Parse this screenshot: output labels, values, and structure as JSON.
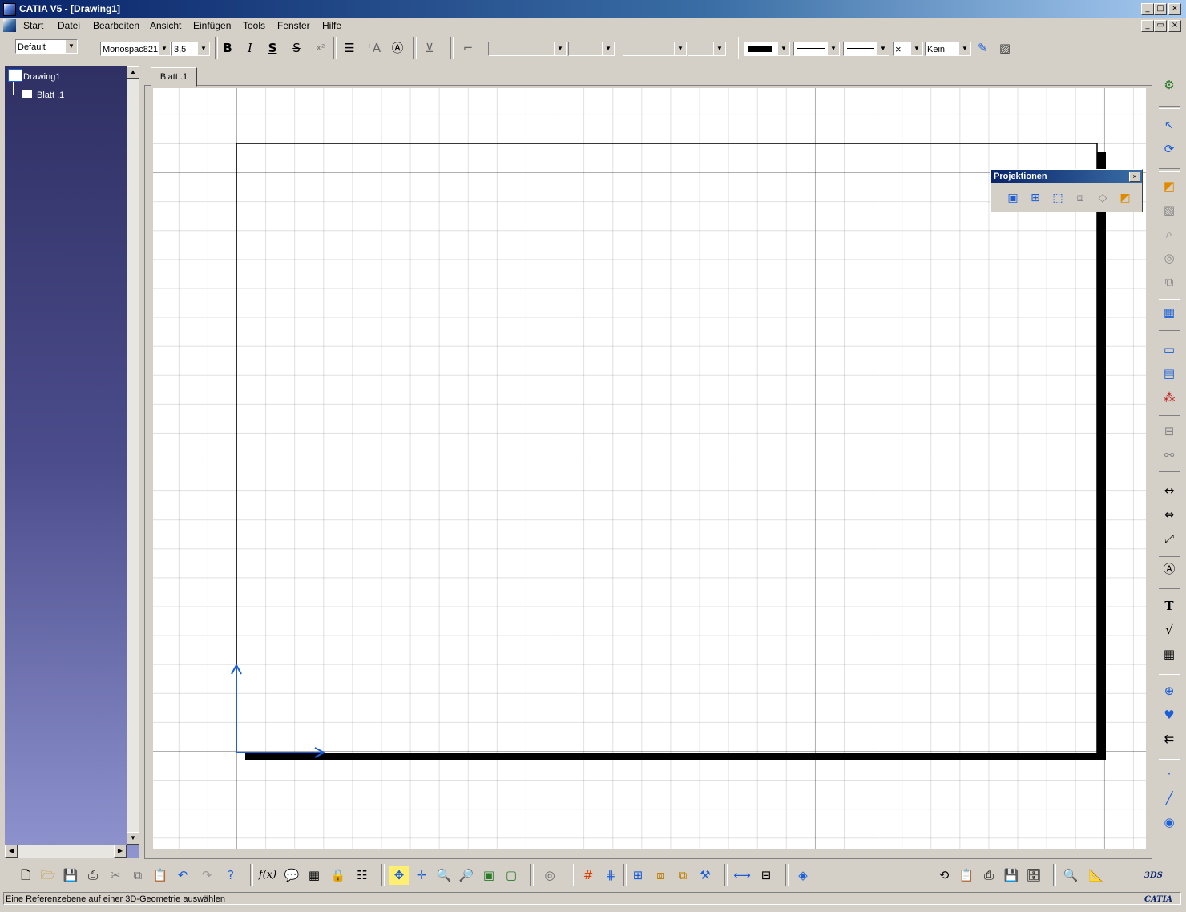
{
  "window": {
    "title": "CATIA V5 - [Drawing1]",
    "controls": [
      "_",
      "□",
      "×"
    ],
    "inner_controls": [
      "_",
      "▭",
      "×"
    ]
  },
  "menu": {
    "items": [
      "Start",
      "Datei",
      "Bearbeiten",
      "Ansicht",
      "Einfügen",
      "Tools",
      "Fenster",
      "Hilfe"
    ]
  },
  "toolbar": {
    "style_combo": "Default",
    "font_combo": "Monospac821",
    "size_combo": "3,5",
    "bold_label": "B",
    "italic_label": "I",
    "underline_label": "S",
    "strike_label": "S",
    "superscript_label": "x²",
    "fill_label": "Kein"
  },
  "tree": {
    "root": "Drawing1",
    "child": "Blatt .1"
  },
  "sheet": {
    "tab_label": "Blatt .1"
  },
  "projektionen": {
    "title": "Projektionen",
    "close": "×"
  },
  "status": {
    "message": "Eine Referenzebene auf einer 3D-Geometrie auswählen"
  },
  "icons": {
    "accent": "#0a246a",
    "axis_color": "#1a5fd8"
  }
}
